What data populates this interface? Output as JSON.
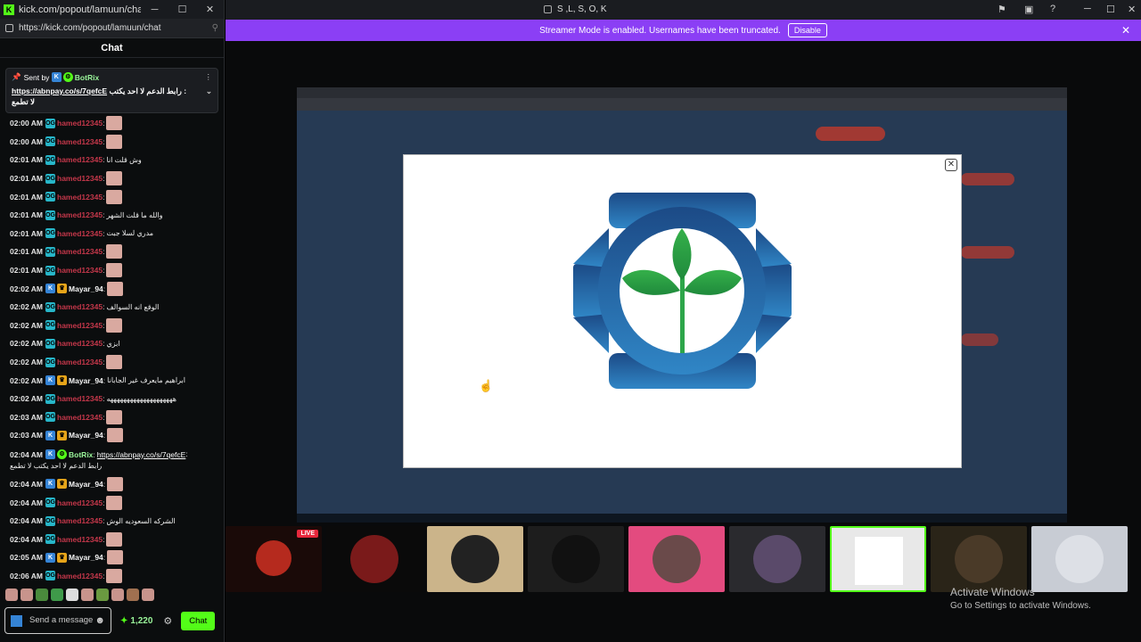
{
  "window": {
    "title": "kick.com/popout/lamuun/chat -...",
    "url": "https://kick.com/popout/lamuun/chat"
  },
  "chat": {
    "header": "Chat",
    "pinned": {
      "sent_by": "Sent by",
      "user": "BotRix",
      "link": "https://abnpay.co/s/7qefcE",
      "text": "رابط الدعم لا احد يكتب :",
      "text2": "لا تطمع"
    },
    "messages": [
      {
        "time": "02:00 AM",
        "user": "hamed12345",
        "text": ""
      },
      {
        "time": "02:00 AM",
        "user": "hamed12345",
        "text": ""
      },
      {
        "time": "02:01 AM",
        "user": "hamed12345",
        "text": "وش قلت انا"
      },
      {
        "time": "02:01 AM",
        "user": "hamed12345",
        "text": ""
      },
      {
        "time": "02:01 AM",
        "user": "hamed12345",
        "text": ""
      },
      {
        "time": "02:01 AM",
        "user": "hamed12345",
        "text": "والله ما قلت الشهر"
      },
      {
        "time": "02:01 AM",
        "user": "hamed12345",
        "text": "مدري لسلا جبت"
      },
      {
        "time": "02:01 AM",
        "user": "hamed12345",
        "text": ""
      },
      {
        "time": "02:01 AM",
        "user": "hamed12345",
        "text": ""
      },
      {
        "time": "02:02 AM",
        "user": "Mayar_94",
        "text": ""
      },
      {
        "time": "02:02 AM",
        "user": "hamed12345",
        "text": "الوقع انه السوالف"
      },
      {
        "time": "02:02 AM",
        "user": "hamed12345",
        "text": ""
      },
      {
        "time": "02:02 AM",
        "user": "hamed12345",
        "text": "ابزي"
      },
      {
        "time": "02:02 AM",
        "user": "hamed12345",
        "text": ""
      },
      {
        "time": "02:02 AM",
        "user": "Mayar_94",
        "text": "ابراهيم مايعرف غير الجابانا"
      },
      {
        "time": "02:02 AM",
        "user": "hamed12345",
        "text": "ههههههههههههههههههههه"
      },
      {
        "time": "02:03 AM",
        "user": "hamed12345",
        "text": ""
      },
      {
        "time": "02:03 AM",
        "user": "Mayar_94",
        "text": ""
      }
    ],
    "bot_message": {
      "time": "02:04 AM",
      "user": "BotRix",
      "link": "https://abnpay.co/s/7qefcE",
      "tail": " :",
      "line2": "رابط الدعم لا احد يكتب لا تطمع"
    },
    "messages2": [
      {
        "time": "02:04 AM",
        "user": "Mayar_94",
        "text": ""
      },
      {
        "time": "02:04 AM",
        "user": "hamed12345",
        "text": ""
      },
      {
        "time": "02:04 AM",
        "user": "hamed12345",
        "text": "الشركه السعوديه الوش"
      },
      {
        "time": "02:04 AM",
        "user": "hamed12345",
        "text": ""
      },
      {
        "time": "02:05 AM",
        "user": "Mayar_94",
        "text": ""
      },
      {
        "time": "02:06 AM",
        "user": "hamed12345",
        "text": ""
      }
    ],
    "input_placeholder": "Send a message",
    "points": "1,220",
    "chat_button": "Chat"
  },
  "browser": {
    "title": "S ,L, S, O, K"
  },
  "streamer_banner": {
    "text": "Streamer Mode is enabled. Usernames have been truncated.",
    "button": "Disable"
  },
  "stream_strip": {
    "live_badge": "LIVE"
  },
  "watermark": {
    "line1": "Activate Windows",
    "line2": "Go to Settings to activate Windows."
  },
  "colors": {
    "kick_green": "#53fc18",
    "streamer_purple": "#8b3ff5",
    "username_red": "#c4374a",
    "logo_blue": "#1f5e97",
    "leaf_green": "#2da64a"
  }
}
